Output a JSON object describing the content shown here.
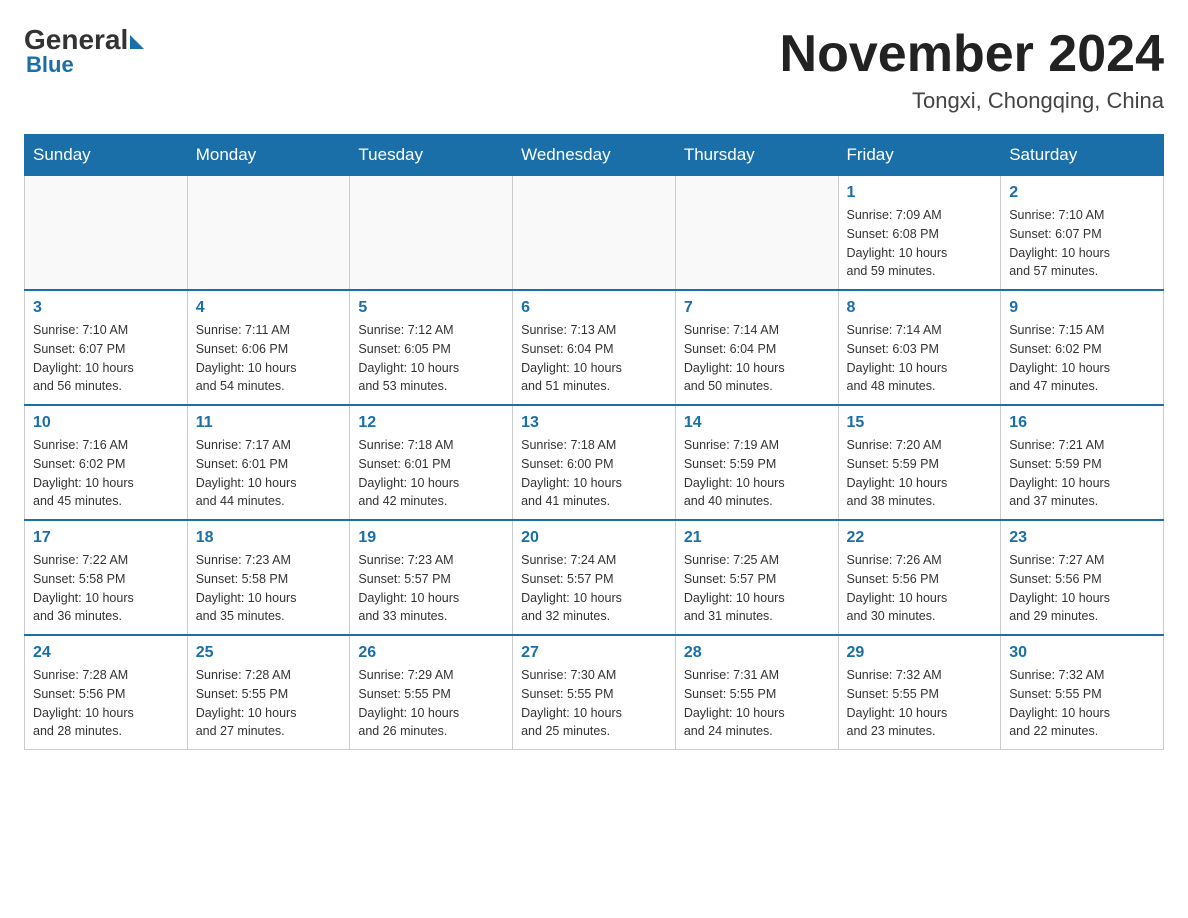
{
  "logo": {
    "general": "General",
    "blue": "Blue"
  },
  "title": "November 2024",
  "location": "Tongxi, Chongqing, China",
  "days_of_week": [
    "Sunday",
    "Monday",
    "Tuesday",
    "Wednesday",
    "Thursday",
    "Friday",
    "Saturday"
  ],
  "weeks": [
    [
      {
        "day": "",
        "info": ""
      },
      {
        "day": "",
        "info": ""
      },
      {
        "day": "",
        "info": ""
      },
      {
        "day": "",
        "info": ""
      },
      {
        "day": "",
        "info": ""
      },
      {
        "day": "1",
        "info": "Sunrise: 7:09 AM\nSunset: 6:08 PM\nDaylight: 10 hours\nand 59 minutes."
      },
      {
        "day": "2",
        "info": "Sunrise: 7:10 AM\nSunset: 6:07 PM\nDaylight: 10 hours\nand 57 minutes."
      }
    ],
    [
      {
        "day": "3",
        "info": "Sunrise: 7:10 AM\nSunset: 6:07 PM\nDaylight: 10 hours\nand 56 minutes."
      },
      {
        "day": "4",
        "info": "Sunrise: 7:11 AM\nSunset: 6:06 PM\nDaylight: 10 hours\nand 54 minutes."
      },
      {
        "day": "5",
        "info": "Sunrise: 7:12 AM\nSunset: 6:05 PM\nDaylight: 10 hours\nand 53 minutes."
      },
      {
        "day": "6",
        "info": "Sunrise: 7:13 AM\nSunset: 6:04 PM\nDaylight: 10 hours\nand 51 minutes."
      },
      {
        "day": "7",
        "info": "Sunrise: 7:14 AM\nSunset: 6:04 PM\nDaylight: 10 hours\nand 50 minutes."
      },
      {
        "day": "8",
        "info": "Sunrise: 7:14 AM\nSunset: 6:03 PM\nDaylight: 10 hours\nand 48 minutes."
      },
      {
        "day": "9",
        "info": "Sunrise: 7:15 AM\nSunset: 6:02 PM\nDaylight: 10 hours\nand 47 minutes."
      }
    ],
    [
      {
        "day": "10",
        "info": "Sunrise: 7:16 AM\nSunset: 6:02 PM\nDaylight: 10 hours\nand 45 minutes."
      },
      {
        "day": "11",
        "info": "Sunrise: 7:17 AM\nSunset: 6:01 PM\nDaylight: 10 hours\nand 44 minutes."
      },
      {
        "day": "12",
        "info": "Sunrise: 7:18 AM\nSunset: 6:01 PM\nDaylight: 10 hours\nand 42 minutes."
      },
      {
        "day": "13",
        "info": "Sunrise: 7:18 AM\nSunset: 6:00 PM\nDaylight: 10 hours\nand 41 minutes."
      },
      {
        "day": "14",
        "info": "Sunrise: 7:19 AM\nSunset: 5:59 PM\nDaylight: 10 hours\nand 40 minutes."
      },
      {
        "day": "15",
        "info": "Sunrise: 7:20 AM\nSunset: 5:59 PM\nDaylight: 10 hours\nand 38 minutes."
      },
      {
        "day": "16",
        "info": "Sunrise: 7:21 AM\nSunset: 5:59 PM\nDaylight: 10 hours\nand 37 minutes."
      }
    ],
    [
      {
        "day": "17",
        "info": "Sunrise: 7:22 AM\nSunset: 5:58 PM\nDaylight: 10 hours\nand 36 minutes."
      },
      {
        "day": "18",
        "info": "Sunrise: 7:23 AM\nSunset: 5:58 PM\nDaylight: 10 hours\nand 35 minutes."
      },
      {
        "day": "19",
        "info": "Sunrise: 7:23 AM\nSunset: 5:57 PM\nDaylight: 10 hours\nand 33 minutes."
      },
      {
        "day": "20",
        "info": "Sunrise: 7:24 AM\nSunset: 5:57 PM\nDaylight: 10 hours\nand 32 minutes."
      },
      {
        "day": "21",
        "info": "Sunrise: 7:25 AM\nSunset: 5:57 PM\nDaylight: 10 hours\nand 31 minutes."
      },
      {
        "day": "22",
        "info": "Sunrise: 7:26 AM\nSunset: 5:56 PM\nDaylight: 10 hours\nand 30 minutes."
      },
      {
        "day": "23",
        "info": "Sunrise: 7:27 AM\nSunset: 5:56 PM\nDaylight: 10 hours\nand 29 minutes."
      }
    ],
    [
      {
        "day": "24",
        "info": "Sunrise: 7:28 AM\nSunset: 5:56 PM\nDaylight: 10 hours\nand 28 minutes."
      },
      {
        "day": "25",
        "info": "Sunrise: 7:28 AM\nSunset: 5:55 PM\nDaylight: 10 hours\nand 27 minutes."
      },
      {
        "day": "26",
        "info": "Sunrise: 7:29 AM\nSunset: 5:55 PM\nDaylight: 10 hours\nand 26 minutes."
      },
      {
        "day": "27",
        "info": "Sunrise: 7:30 AM\nSunset: 5:55 PM\nDaylight: 10 hours\nand 25 minutes."
      },
      {
        "day": "28",
        "info": "Sunrise: 7:31 AM\nSunset: 5:55 PM\nDaylight: 10 hours\nand 24 minutes."
      },
      {
        "day": "29",
        "info": "Sunrise: 7:32 AM\nSunset: 5:55 PM\nDaylight: 10 hours\nand 23 minutes."
      },
      {
        "day": "30",
        "info": "Sunrise: 7:32 AM\nSunset: 5:55 PM\nDaylight: 10 hours\nand 22 minutes."
      }
    ]
  ]
}
